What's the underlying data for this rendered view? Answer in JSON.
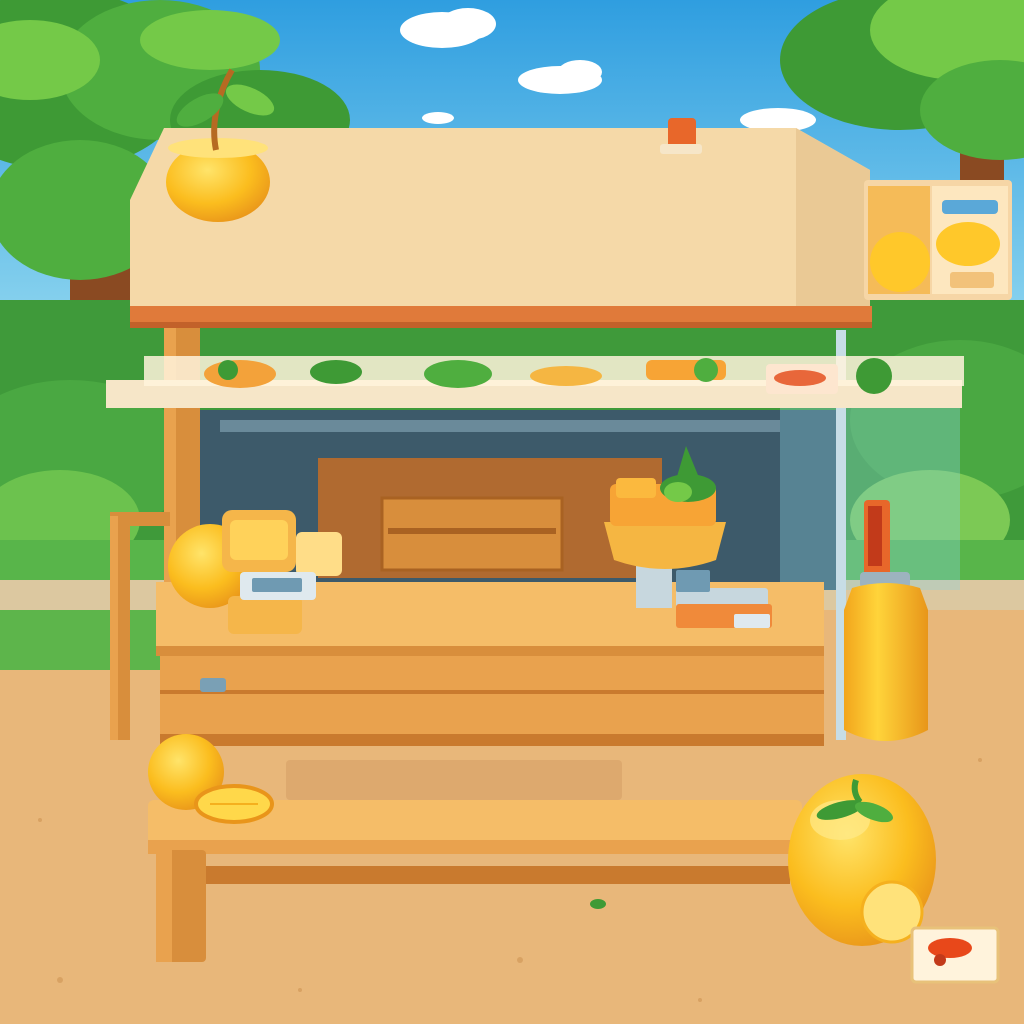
{
  "scene": {
    "colors": {
      "sky_top": "#2f9ee0",
      "sky_bottom": "#7fcfee",
      "cloud": "#ffffff",
      "hedge_dark": "#3f9a3a",
      "hedge_light": "#6cc24e",
      "grass": "#58b54a",
      "ground": "#e8b77a",
      "ground_dark": "#d8a263",
      "roof": "#f5d9a8",
      "roof_trim": "#e07a3a",
      "wood": "#e9a24e",
      "wood_dark": "#c97a2e",
      "wood_light": "#f5bd68",
      "interior": "#3d5a6a",
      "orange": "#f9b51c",
      "orange_light": "#ffd84a",
      "juice": "#ffc72a",
      "leaf": "#3e9a35",
      "leaf_light": "#74c948",
      "trunk": "#8a4a22"
    },
    "items": [
      {
        "name": "roof-potted-plant",
        "icon": "potted-orange-plant"
      },
      {
        "name": "roof-juice-cup",
        "icon": "juice-cup"
      },
      {
        "name": "juice-menu-sign",
        "icon": "juice-jars"
      },
      {
        "name": "counter-orange",
        "icon": "orange"
      },
      {
        "name": "juicer-machine",
        "icon": "juicer"
      },
      {
        "name": "cash-register",
        "icon": "register"
      },
      {
        "name": "juice-bottle",
        "icon": "bottle"
      },
      {
        "name": "bench-oranges",
        "icon": "orange-slices"
      },
      {
        "name": "big-orange",
        "icon": "orange"
      },
      {
        "name": "ground-juice-packet",
        "icon": "packet"
      }
    ]
  }
}
